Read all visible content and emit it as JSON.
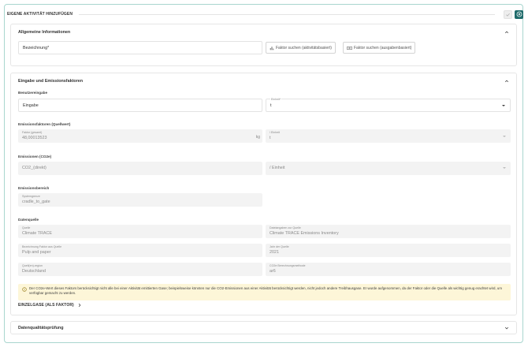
{
  "header": {
    "title": "EIGENE AKTIVITÄT HINZUFÜGEN"
  },
  "general": {
    "title": "Allgemeine Informationen",
    "name_placeholder": "Bezeichnung*",
    "search_activity": "Faktor suchen (aktivitätsbasiert)",
    "search_expense": "Faktor suchen (ausgabenbasiert)"
  },
  "input": {
    "title": "Eingabe und Emissionsfaktoren",
    "user_input_label": "Benutzereingabe",
    "input_placeholder": "Eingabe",
    "unit_label": "Einheit*",
    "unit_value": "t",
    "factors_label": "Emissionsfaktoren (Quellwert)",
    "factor_field_label": "Faktor (gesamt)",
    "factor_value": "48,00013523",
    "factor_unit": "kg",
    "per_unit_label": "/ Einheit",
    "per_unit_value": "t",
    "emissions_label": "Emissionen (CO2e)",
    "emissions_value": "CO2_(direkt)",
    "emissions_unit": "/ Einheit",
    "scope_label": "Emissionsbereich",
    "boundary_label": "Systemgrenze",
    "boundary_value": "cradle_to_gate",
    "source_section": "Datenquelle",
    "source_label": "Quelle",
    "source_value": "Climate TRACE",
    "source_name_label": "Dateiangaben zur Quelle",
    "source_name_value": "Climate TRACE Emissions Inventory",
    "factor_name_label": "Bezeichnung Faktor aus Quelle",
    "factor_name_value": "Pulp and paper",
    "year_label": "Jahr der Quelle",
    "year_value": "2021",
    "region_label": "Quell(en)-region",
    "region_value": "Deutschland",
    "method_label": "CO2e Berechnungsmethode",
    "method_value": "ar6",
    "notice": "Der CO2e-Wert dieses Faktors berücksichtigt nicht alle bei einer Aktivität emittierten Gase; beispielsweise könnten nur die CO2-Emissionen aus einer Aktivität berücksichtigt werden, nicht jedoch andere Treibhausgase. Er wurde aufgenommen, da der Faktor oder die Quelle als wichtig genug erachtet wird, um verfügbar gemacht zu werden.",
    "single_gases": "EINZELGASE (ALS FAKTOR)"
  },
  "quality": {
    "title": "Datenqualitätsprüfung"
  },
  "colors": {
    "accent": "#1f6b6b",
    "notice_bg": "#fdf6d8",
    "frame_border": "#a9d6cf"
  }
}
